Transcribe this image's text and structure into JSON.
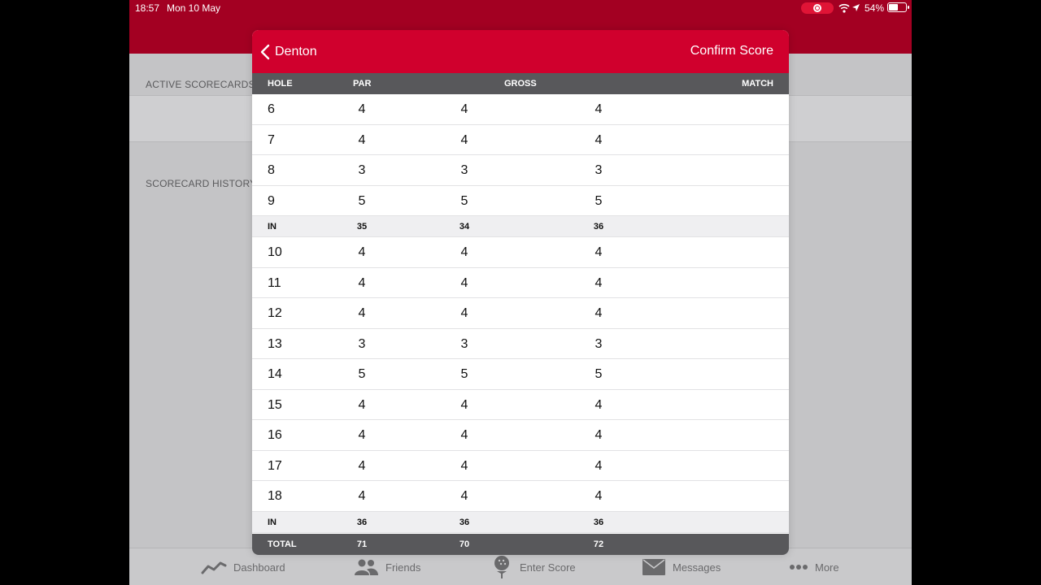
{
  "status_bar": {
    "time": "18:57",
    "date": "Mon 10 May",
    "battery": "54%",
    "battery_level": 0.54
  },
  "background": {
    "active_label": "ACTIVE SCORECARDS",
    "history_label": "SCORECARD HISTORY"
  },
  "modal": {
    "back_label": "Denton",
    "confirm_label": "Confirm Score",
    "columns": {
      "hole": "HOLE",
      "par": "PAR",
      "gross": "GROSS",
      "match": "MATCH"
    },
    "rows_a": [
      {
        "hole": "6",
        "par": "4",
        "gross": "4",
        "match": "4"
      },
      {
        "hole": "7",
        "par": "4",
        "gross": "4",
        "match": "4"
      },
      {
        "hole": "8",
        "par": "3",
        "gross": "3",
        "match": "3"
      },
      {
        "hole": "9",
        "par": "5",
        "gross": "5",
        "match": "5"
      }
    ],
    "subtotal_a": {
      "label": "IN",
      "par": "35",
      "gross": "34",
      "match": "36"
    },
    "rows_b": [
      {
        "hole": "10",
        "par": "4",
        "gross": "4",
        "match": "4"
      },
      {
        "hole": "11",
        "par": "4",
        "gross": "4",
        "match": "4"
      },
      {
        "hole": "12",
        "par": "4",
        "gross": "4",
        "match": "4"
      },
      {
        "hole": "13",
        "par": "3",
        "gross": "3",
        "match": "3"
      },
      {
        "hole": "14",
        "par": "5",
        "gross": "5",
        "match": "5"
      },
      {
        "hole": "15",
        "par": "4",
        "gross": "4",
        "match": "4"
      },
      {
        "hole": "16",
        "par": "4",
        "gross": "4",
        "match": "4"
      },
      {
        "hole": "17",
        "par": "4",
        "gross": "4",
        "match": "4"
      },
      {
        "hole": "18",
        "par": "4",
        "gross": "4",
        "match": "4"
      }
    ],
    "subtotal_b": {
      "label": "IN",
      "par": "36",
      "gross": "36",
      "match": "36"
    },
    "total": {
      "label": "TOTAL",
      "par": "71",
      "gross": "70",
      "match": "72"
    }
  },
  "tab_bar": {
    "items": [
      {
        "label": "Dashboard",
        "icon": "chart-line-icon"
      },
      {
        "label": "Friends",
        "icon": "people-icon"
      },
      {
        "label": "Enter Score",
        "icon": "golf-ball-tee-icon"
      },
      {
        "label": "Messages",
        "icon": "envelope-icon"
      },
      {
        "label": "More",
        "icon": "ellipsis-icon"
      }
    ]
  },
  "colors": {
    "brand_red": "#d0002d",
    "header_dark_red": "#a30022",
    "table_header": "#58585b"
  }
}
